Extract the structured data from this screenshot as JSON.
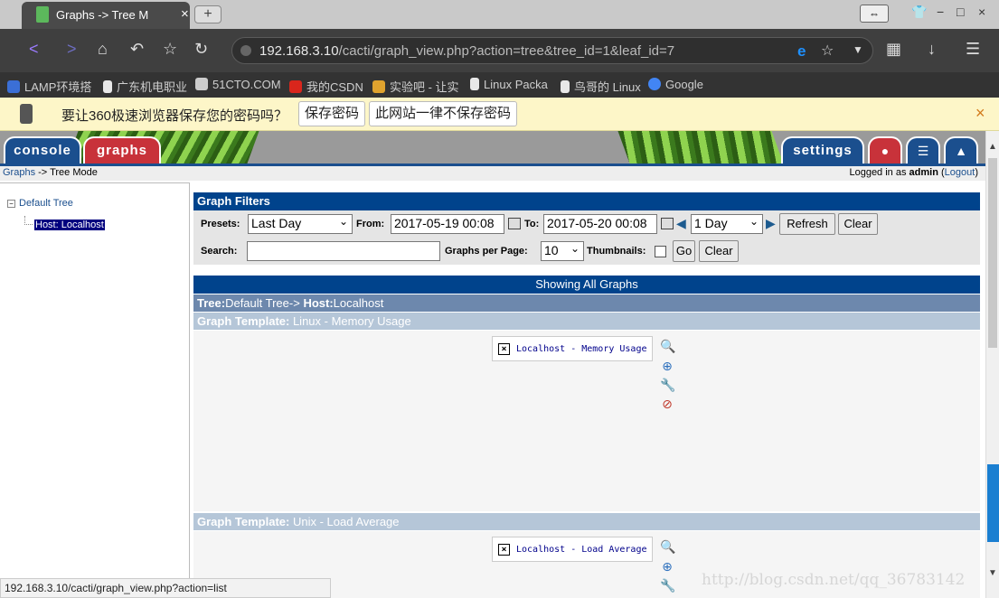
{
  "browser": {
    "tab_title": "Graphs -> Tree M",
    "tab_close": "×",
    "new_tab": "+",
    "address_host": "192.168.3.10",
    "address_path": "/cacti/graph_view.php?action=tree&tree_id=1&leaf_id=7",
    "window_buttons": [
      "−",
      "□",
      "×"
    ]
  },
  "bookmarks": [
    {
      "label": "LAMP环境搭",
      "color": "#3b6fd6"
    },
    {
      "label": "广东机电职业",
      "color": "#e8e8e8"
    },
    {
      "label": "51CTO.COM",
      "color": "#cccccc"
    },
    {
      "label": "我的CSDN",
      "color": "#d9261c"
    },
    {
      "label": "实验吧 - 让实",
      "color": "#e0a32e"
    },
    {
      "label": "Linux Packa",
      "color": "#e8e8e8"
    },
    {
      "label": "鸟哥的 Linux",
      "color": "#e8e8e8"
    },
    {
      "label": "Google",
      "color": "#4285f4"
    }
  ],
  "password_bar": {
    "message": "要让360极速浏览器保存您的密码吗？",
    "save_label": "保存密码",
    "never_label": "此网站一律不保存密码",
    "close": "×"
  },
  "cacti": {
    "tabs": {
      "console": "console",
      "graphs": "graphs",
      "settings": "settings"
    },
    "breadcrumb": {
      "link": "Graphs",
      "rest": " -> Tree Mode"
    },
    "login": {
      "prefix": "Logged in as ",
      "user": "admin",
      "open": " (",
      "logout": "Logout",
      "close": ")"
    },
    "tree": {
      "root": "Default Tree",
      "root_toggle": "−",
      "leaf": "Host: Localhost"
    },
    "filters": {
      "title": "Graph Filters",
      "presets_label": "Presets:",
      "presets_value": "Last Day",
      "from_label": "From:",
      "from_value": "2017-05-19 00:08",
      "to_label": "To:",
      "to_value": "2017-05-20 00:08",
      "shift_value": "1 Day",
      "refresh": "Refresh",
      "clear": "Clear",
      "search_label": "Search:",
      "search_value": "",
      "per_page_label": "Graphs per Page:",
      "per_page_value": "10",
      "thumbnails_label": "Thumbnails:",
      "go": "Go",
      "clear2": "Clear"
    },
    "showing": "Showing All Graphs",
    "tree_header": {
      "tree_label": "Tree:",
      "tree_value": "Default Tree",
      "arrow": "-> ",
      "host_label": "Host:",
      "host_value": "Localhost"
    },
    "templates": [
      {
        "label": "Graph Template:",
        "value": " Linux - Memory Usage",
        "graph": "Localhost - Memory Usage"
      },
      {
        "label": "Graph Template:",
        "value": " Unix - Load Average",
        "graph": "Localhost - Load Average"
      }
    ]
  },
  "status_url": "192.168.3.10/cacti/graph_view.php?action=list",
  "watermark": "http://blog.csdn.net/qq_36783142"
}
